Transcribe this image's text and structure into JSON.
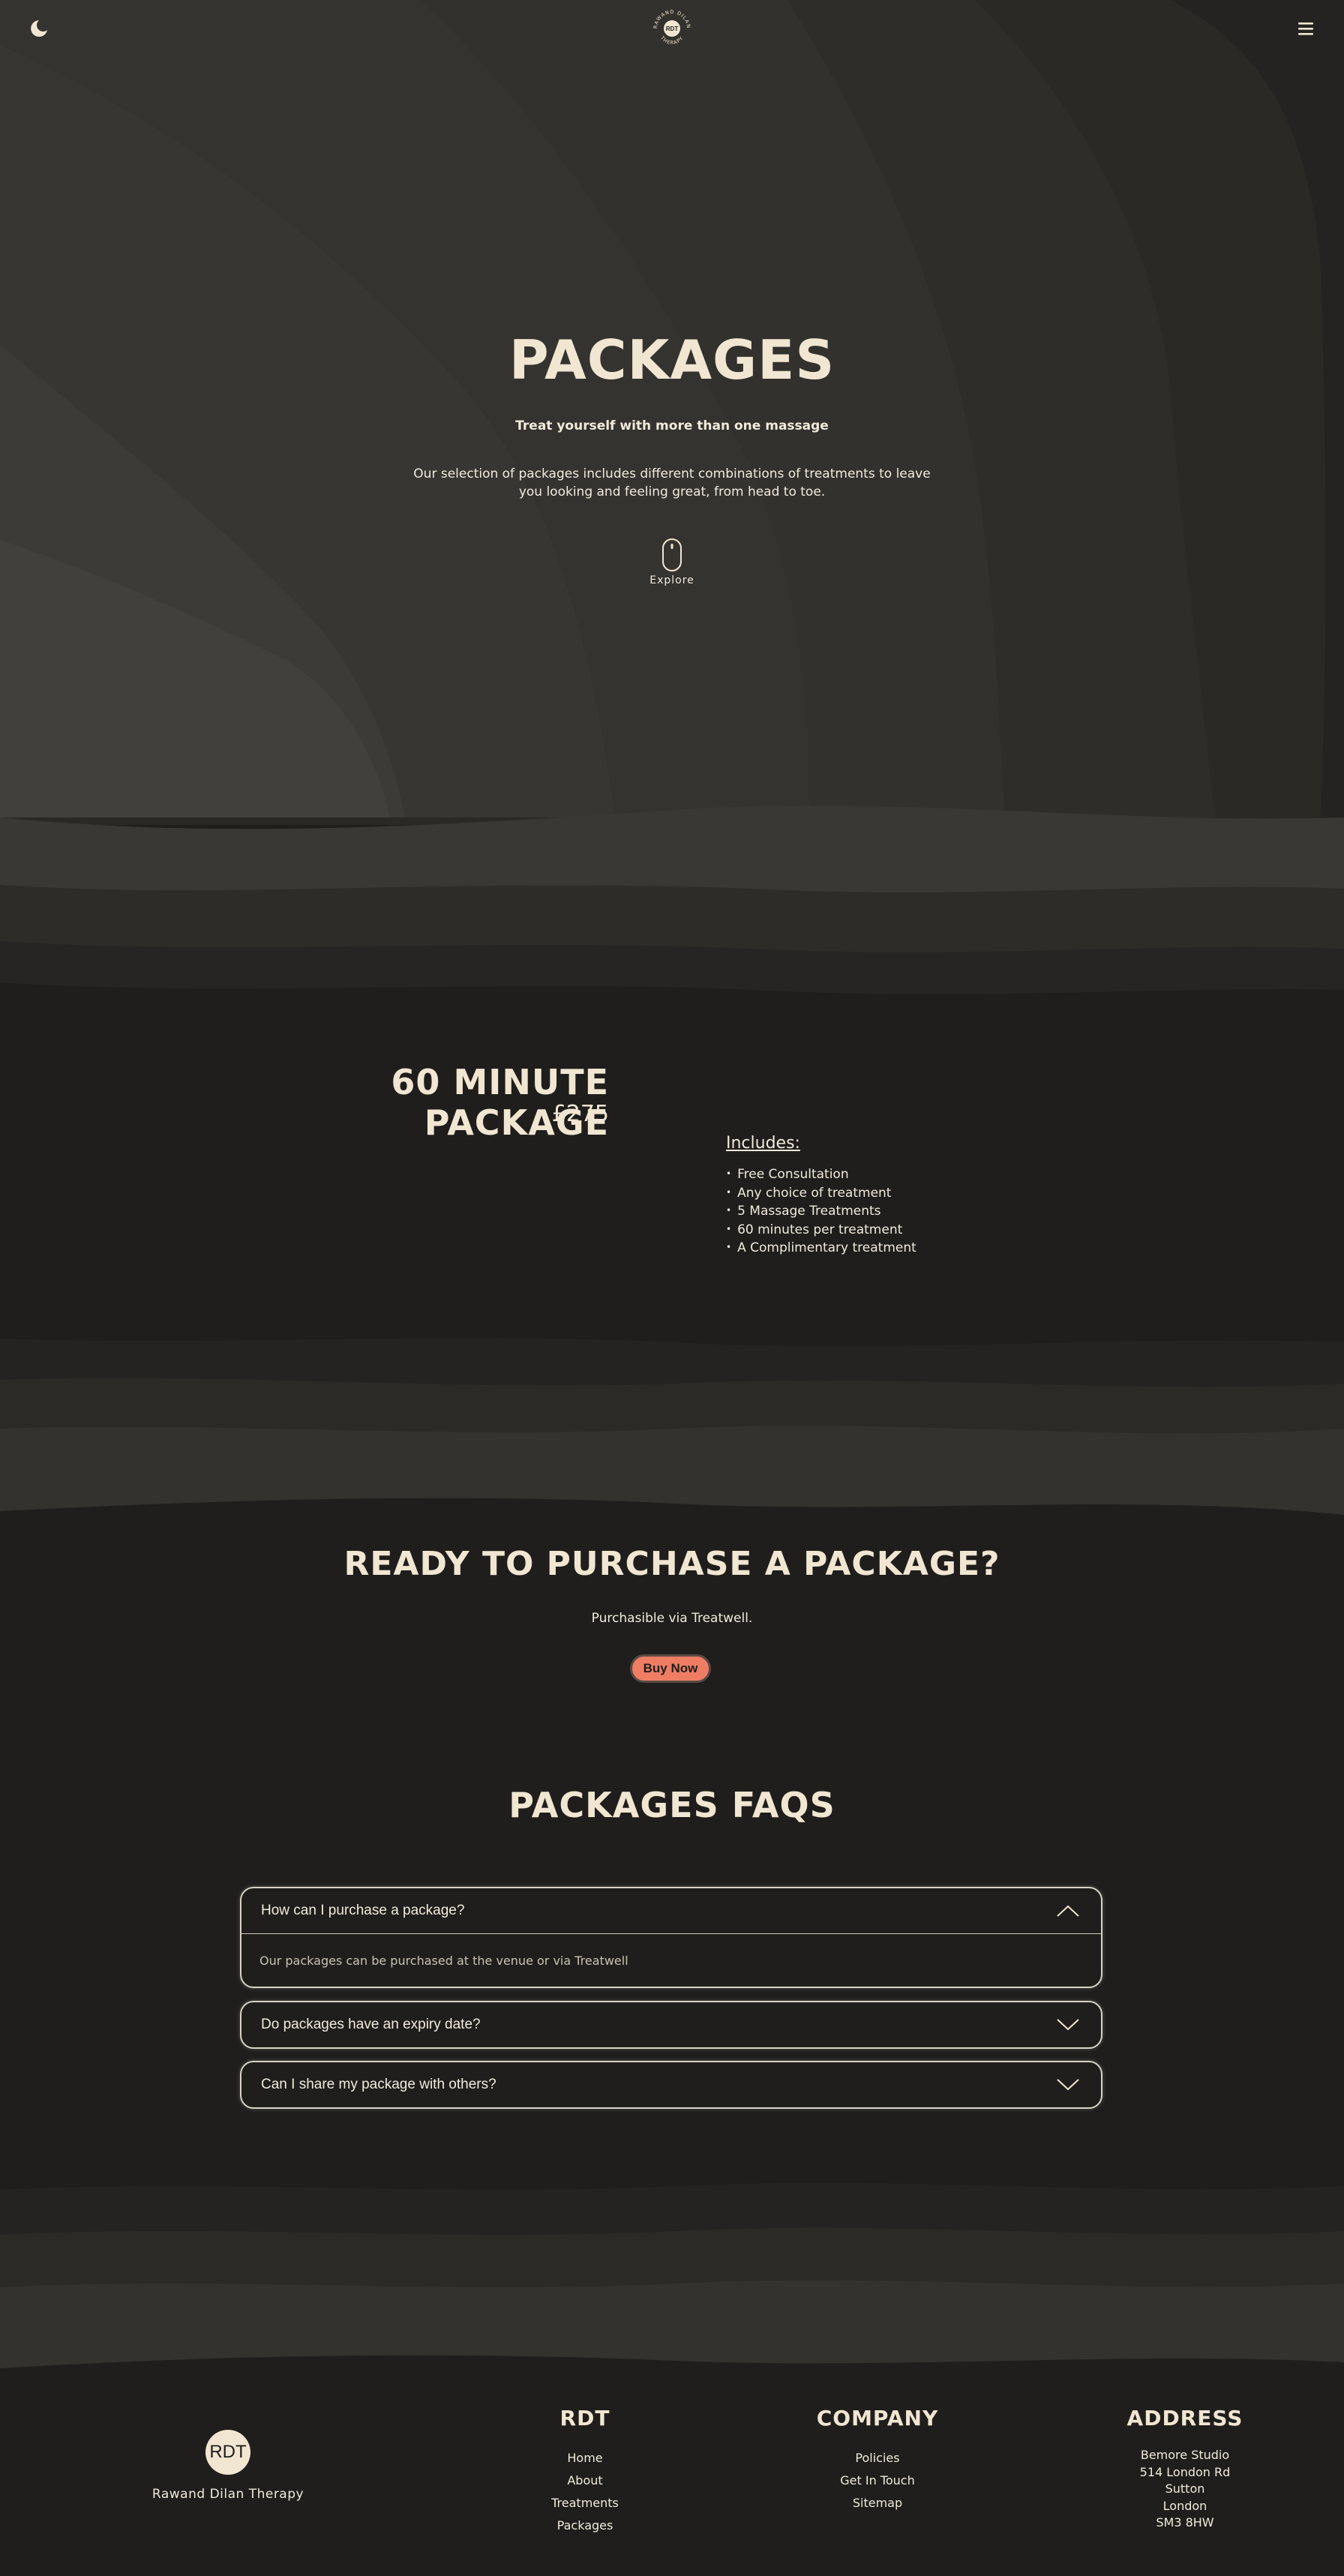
{
  "header": {
    "theme_toggle_icon": "moon-icon",
    "logo_text": "RAWAND DILAN THERAPY",
    "logo_mark": "RDT",
    "menu_icon": "hamburger-icon"
  },
  "hero": {
    "title": "PACKAGES",
    "subtitle": "Treat yourself with more than one massage",
    "description": "Our selection of packages includes different combinations of treatments to leave you looking and feeling great, from head to toe.",
    "explore_label": "Explore"
  },
  "package": {
    "title": "60 MINUTE PACKAGE",
    "price": "£275",
    "includes_label": "Includes:",
    "items": [
      "Free Consultation",
      "Any choice of treatment",
      "5 Massage Treatments",
      "60 minutes per treatment",
      "A Complimentary treatment"
    ]
  },
  "purchase": {
    "title": "READY TO PURCHASE A PACKAGE?",
    "subtitle": "Purchasible via Treatwell.",
    "button_label": "Buy Now"
  },
  "faq": {
    "title": "PACKAGES FAQS",
    "items": [
      {
        "question": "How can I purchase a package?",
        "answer": "Our packages can be purchased at the venue or via Treatwell",
        "expanded": true
      },
      {
        "question": "Do packages have an expiry date?",
        "expanded": false
      },
      {
        "question": "Can I share my package with others?",
        "expanded": false
      }
    ]
  },
  "footer": {
    "logo_text": "RDT",
    "business_name": "Rawand Dilan Therapy",
    "rdt": {
      "heading": "RDT",
      "links": [
        "Home",
        "About",
        "Treatments",
        "Packages"
      ]
    },
    "company": {
      "heading": "COMPANY",
      "links": [
        "Policies",
        "Get In Touch",
        "Sitemap"
      ]
    },
    "address": {
      "heading": "ADDRESS",
      "lines": [
        "Bemore Studio",
        "514 London Rd",
        "Sutton",
        "London",
        "SM3 8HW"
      ]
    }
  },
  "colors": {
    "background": "#1f1e1c",
    "text": "#f1ebdd",
    "accent": "#ef7d64"
  }
}
